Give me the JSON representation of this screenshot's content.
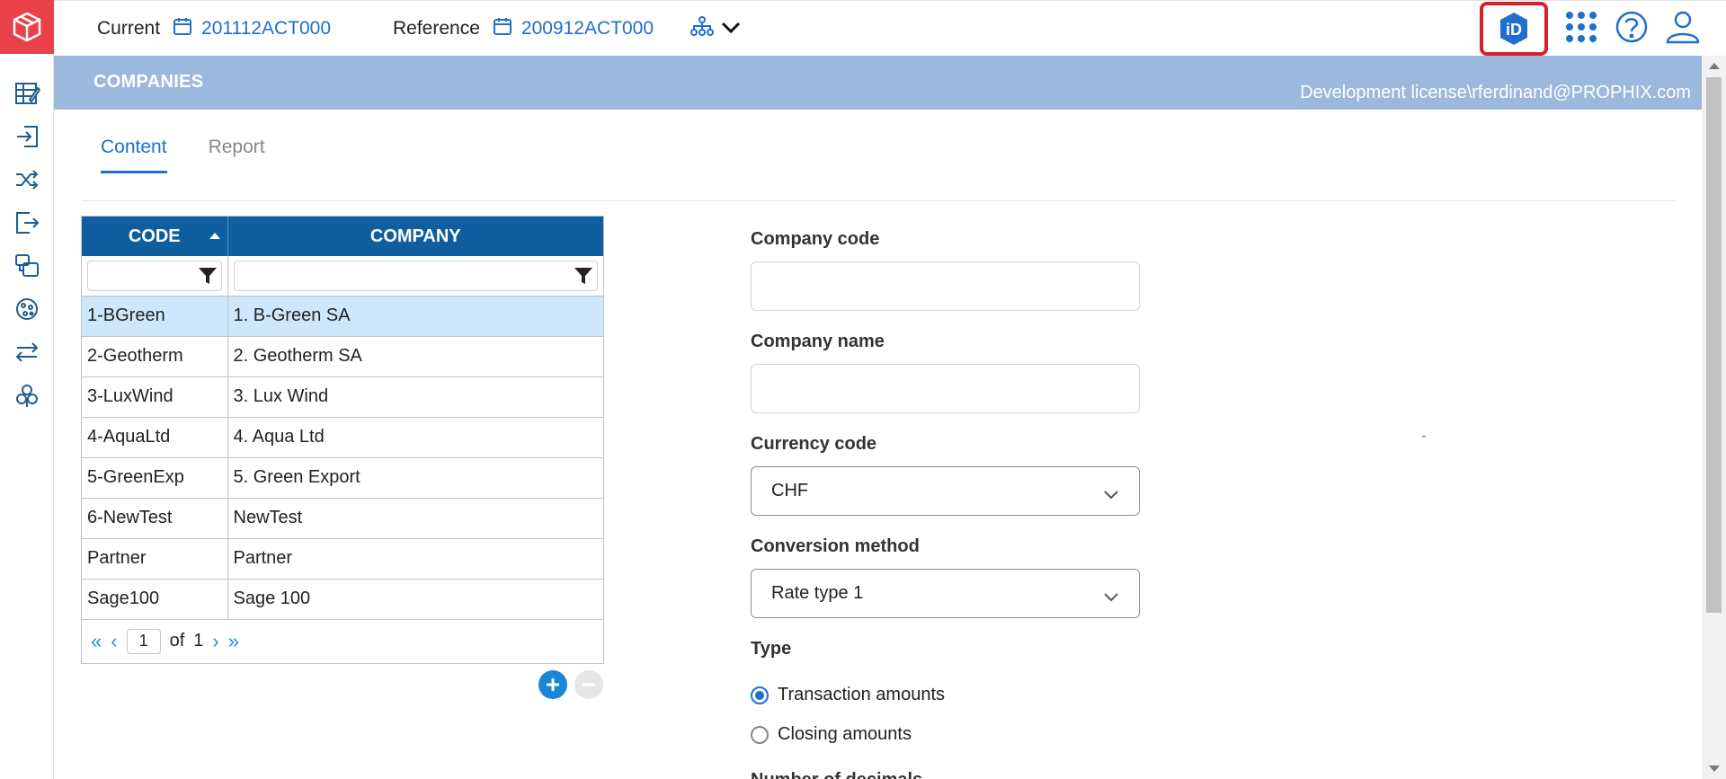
{
  "app": {
    "logo_icon": "cube-logo-icon",
    "brand_color": "#e8414a"
  },
  "sidebar": {
    "items": [
      {
        "name": "edit-grid-icon"
      },
      {
        "name": "import-icon"
      },
      {
        "name": "shuffle-icon"
      },
      {
        "name": "export-icon"
      },
      {
        "name": "copy-icon"
      },
      {
        "name": "globe-icon"
      },
      {
        "name": "swap-icon"
      },
      {
        "name": "propeller-icon"
      }
    ]
  },
  "topbar": {
    "current_label": "Current",
    "current_value": "201112ACT000",
    "reference_label": "Reference",
    "reference_value": "200912ACT000",
    "hierarchy_icon": "hierarchy-icon",
    "right_icons": [
      "id-badge-icon",
      "apps-grid-icon",
      "help-icon",
      "user-icon"
    ]
  },
  "header": {
    "title": "COMPANIES",
    "user": "Development license\\rferdinand@PROPHIX.com"
  },
  "tabs": [
    {
      "label": "Content",
      "active": true
    },
    {
      "label": "Report",
      "active": false
    }
  ],
  "grid": {
    "columns": [
      "CODE",
      "COMPANY"
    ],
    "rows": [
      {
        "code": "1-BGreen",
        "company": "1. B-Green SA",
        "selected": true
      },
      {
        "code": "2-Geotherm",
        "company": "2. Geotherm SA"
      },
      {
        "code": "3-LuxWind",
        "company": "3. Lux Wind"
      },
      {
        "code": "4-AquaLtd",
        "company": "4. Aqua Ltd"
      },
      {
        "code": "5-GreenExp",
        "company": "5. Green Export"
      },
      {
        "code": "6-NewTest",
        "company": "NewTest"
      },
      {
        "code": "Partner",
        "company": "Partner"
      },
      {
        "code": "Sage100",
        "company": "Sage 100"
      }
    ],
    "pager": {
      "page": "1",
      "of_label": "of",
      "total": "1"
    }
  },
  "form": {
    "company_code_label": "Company code",
    "company_code_value": "",
    "company_name_label": "Company name",
    "company_name_value": "",
    "currency_label": "Currency code",
    "currency_value": "CHF",
    "conversion_label": "Conversion method",
    "conversion_value": "Rate type 1",
    "type_label": "Type",
    "type_options": [
      {
        "label": "Transaction amounts",
        "checked": true
      },
      {
        "label": "Closing amounts",
        "checked": false
      }
    ],
    "cut_label": "Number of decimals"
  }
}
